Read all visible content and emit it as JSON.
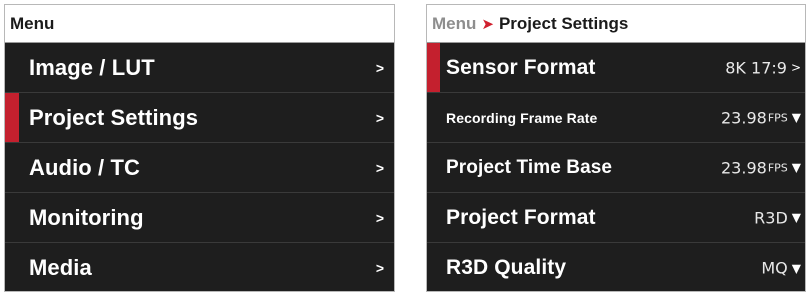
{
  "left_panel": {
    "title": "Menu",
    "items": [
      {
        "label": "Image / LUT",
        "chevron": ">"
      },
      {
        "label": "Project Settings",
        "chevron": ">",
        "selected": true
      },
      {
        "label": "Audio / TC",
        "chevron": ">"
      },
      {
        "label": "Monitoring",
        "chevron": ">"
      },
      {
        "label": "Media",
        "chevron": ">"
      }
    ]
  },
  "right_panel": {
    "breadcrumb": {
      "root": "Menu",
      "separator": "➤",
      "current": "Project Settings"
    },
    "items": [
      {
        "label": "Sensor Format",
        "value": "8K 17:9",
        "unit": "",
        "arrow": ">",
        "selected": true
      },
      {
        "label": "Recording Frame Rate",
        "value": "23.98",
        "unit": "FPS",
        "arrow": "▼"
      },
      {
        "label": "Project Time Base",
        "value": "23.98",
        "unit": "FPS",
        "arrow": "▼"
      },
      {
        "label": "Project Format",
        "value": "R3D",
        "unit": "",
        "arrow": "▼"
      },
      {
        "label": "R3D Quality",
        "value": "MQ",
        "unit": "",
        "arrow": "▼"
      }
    ]
  },
  "colors": {
    "panel_background": "#1e1e1e",
    "header_background": "#ffffff",
    "selection_accent": "#c4202e",
    "breadcrumb_separator": "#d0202e"
  }
}
